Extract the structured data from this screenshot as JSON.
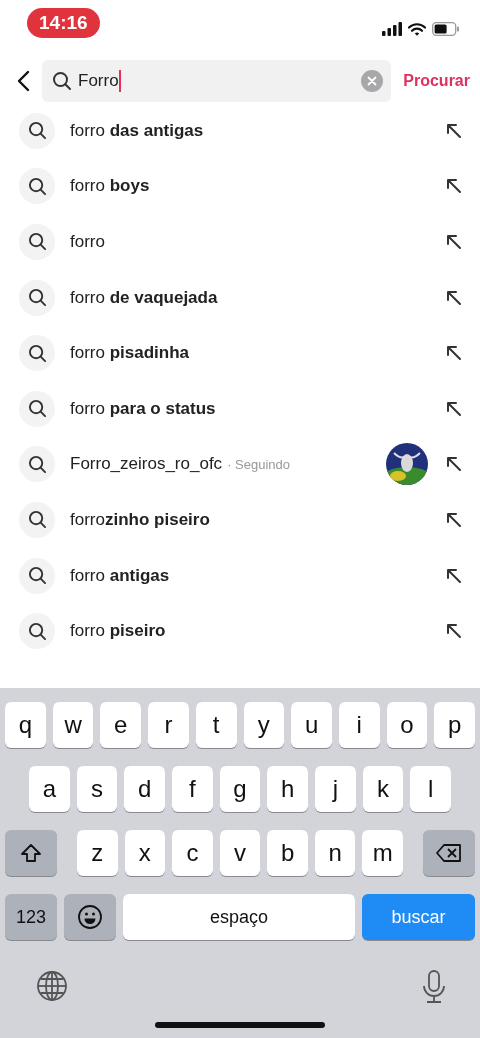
{
  "status_bar": {
    "time": "14:16"
  },
  "search": {
    "value": "Forro",
    "action": "Procurar"
  },
  "suggestions": [
    {
      "kind": "query",
      "text": "forro **das antigas**"
    },
    {
      "kind": "query",
      "text": "forro **boys**"
    },
    {
      "kind": "query",
      "text": "forro"
    },
    {
      "kind": "query",
      "text": "forro **de vaquejada**"
    },
    {
      "kind": "query",
      "text": "forro **pisadinha**"
    },
    {
      "kind": "query",
      "text": "forro **para o status**"
    },
    {
      "kind": "account",
      "text": "Forro_zeiros_ro_ofc",
      "note": "· Seguindo"
    },
    {
      "kind": "query",
      "text": "forro**zinho piseiro**"
    },
    {
      "kind": "query",
      "text": "forro **antigas**"
    },
    {
      "kind": "query",
      "text": "forro **piseiro**"
    }
  ],
  "keyboard": {
    "rows": [
      [
        "q",
        "w",
        "e",
        "r",
        "t",
        "y",
        "u",
        "i",
        "o",
        "p"
      ],
      [
        "a",
        "s",
        "d",
        "f",
        "g",
        "h",
        "j",
        "k",
        "l"
      ],
      [
        "z",
        "x",
        "c",
        "v",
        "b",
        "n",
        "m"
      ]
    ],
    "numbers_key": "123",
    "space_key": "espaço",
    "action_key": "buscar"
  }
}
